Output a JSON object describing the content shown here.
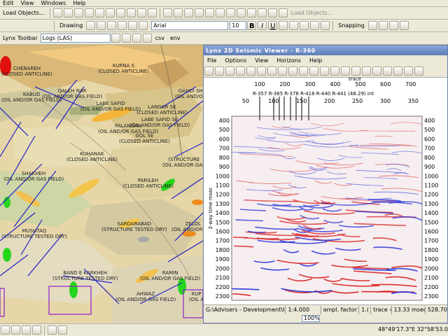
{
  "menubar": {
    "items": [
      "Edit",
      "View",
      "Windows",
      "Help"
    ]
  },
  "toolbar1": {
    "load_objects_left": "Load Objects...",
    "load_objects_right": "Load Objects..."
  },
  "toolbar2": {
    "drawing_label": "Drawing",
    "font_name": "Arial",
    "font_size": "10",
    "snapping_label": "Snapping"
  },
  "toolbar3": {
    "lynx_toolbar": "Lynx Toolbar",
    "logs_value": "Logs (LAS)",
    "csv_label": "csv",
    "env_label": "env"
  },
  "map": {
    "labels": [
      {
        "text": "CHENAREH\n(CLOSED ANTICLINE)"
      },
      {
        "text": "KURNA S\n(CLOSED ANTICLINE)"
      },
      {
        "text": "KABUD\n(OIL AND/OR GAS FIELD)"
      },
      {
        "text": "QALEH NAR\n(OIL AND/OR GAS FIELD)"
      },
      {
        "text": "LABE SAFID\n(OIL AND/OR GAS FIELD)"
      },
      {
        "text": "GANDI SH\n(OIL AND/OR"
      },
      {
        "text": "LANGAR SE\n(CLOSED ANTICLINE)"
      },
      {
        "text": "LABE SAFID SE\n(OIL AND/OR GAS FIELD)"
      },
      {
        "text": "PALANGAN\n(OIL AND/OR GAS FIELD)"
      },
      {
        "text": "GOL SE\n(CLOSED ANTICLINE)"
      },
      {
        "text": "KUHANAK\n(CLOSED ANTICLINE)"
      },
      {
        "text": "SHAKHEH\n(OIL AND/OR GAS FIELD)"
      },
      {
        "text": "PARILEH\n(CLOSED ANTICLINE)"
      },
      {
        "text": "(STRUCTURE\n(OIL AND/OR GAS"
      },
      {
        "text": "SARDARABAD\n(STRUCTURE TESTED DRY)"
      },
      {
        "text": "MUSHTAQ\n(STRUCTURE TESTED DRY)"
      },
      {
        "text": "ZELOL\n(OIL AND/OR GAS"
      },
      {
        "text": "BAND E KARKHEH\n(STRUCTURE TESTED DRY)"
      },
      {
        "text": "RAMIN\n(OIL AND/OR GAS FIELD)"
      },
      {
        "text": "AHWAZ\n(OIL AND/OR GAS FIELD)"
      },
      {
        "text": "KUP\n(OIL A"
      }
    ]
  },
  "seismic": {
    "title": "Lynx 2D Seismic Viewer - R-360",
    "menu": [
      "File",
      "Options",
      "View",
      "Horizons",
      "Help"
    ],
    "axis_top_title": "trace",
    "trace_ticks_top": [
      "100",
      "200",
      "300",
      "400",
      "500",
      "600",
      "700"
    ],
    "trace_ticks_mid": [
      "50",
      "100",
      "150",
      "200",
      "250",
      "300",
      "350"
    ],
    "intersect_label": "R-357 R-365 R-378 R-418 R-440 R-441 (48.29) int",
    "ylabel": "2-way time msec",
    "y_ticks": [
      "400",
      "500",
      "600",
      "700",
      "800",
      "900",
      "1000",
      "1100",
      "1200",
      "1300",
      "1400",
      "1500",
      "1600",
      "1700",
      "1800",
      "1900",
      "2000",
      "2100",
      "2200",
      "2300"
    ],
    "status": {
      "path": "G:\\Advisers - Development\\Iran\\LL34",
      "scale": "1:4.000",
      "ampl": "ampl. factor =",
      "ampl_val": "1.(",
      "trace": "trace =",
      "time": "13.33 msec =",
      "time_val": "528.70"
    },
    "zoom": "100%"
  },
  "statusbar": {
    "coords": "48°49'17.3\"E  32°58'53.02\"N"
  },
  "colors": {
    "seismic_red": "#d81e1e",
    "seismic_blue": "#1e2ad8",
    "map_base": "#e6d6a8",
    "title_bar": "#6e8cc8"
  }
}
